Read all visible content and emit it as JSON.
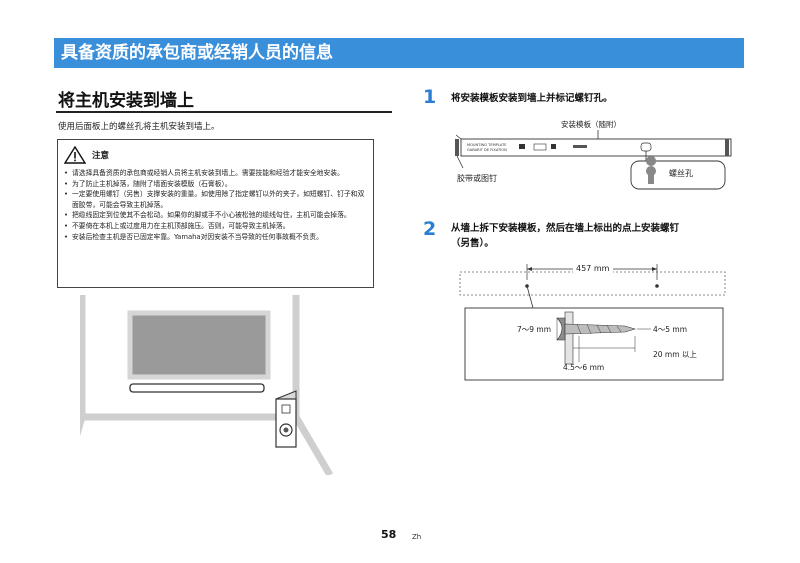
{
  "banner_title": "具备资质的承包商或经销人员的信息",
  "section_title": "将主机安装到墙上",
  "intro": "使用后面板上的螺丝孔将主机安装到墙上。",
  "caution": {
    "title": "注意",
    "items": [
      "请选择具备资质的承包商或经销人员将主机安装到墙上。需要技能和经验才能安全地安装。",
      "为了防止主机掉落，随附了墙面安装模版（石膏板）。",
      "一定要使用螺钉（另售）支撑安装的重量。如使用除了指定螺钉以外的夹子，如短螺钉、钉子和双面胶带，可能会导致主机掉落。",
      "把缆线固定到位使其不会松动。如果你的脚或手不小心被松弛的缆线勾住，主机可能会掉落。",
      "不要倚在本机上或过度用力在主机顶部施压。否则，可能导致主机掉落。",
      "安装后检查主机是否已固定牢靠。Yamaha对因安装不当导致的任何事故概不负责。"
    ]
  },
  "step1": {
    "number": "1",
    "text": "将安装模板安装到墙上并标记螺钉孔。",
    "template_label": "安装模板（随附）",
    "tape_label": "胶带或图钉",
    "hole_label": "螺丝孔",
    "template_print_1": "MOUNTING TEMPLATE",
    "template_print_2": "GABARIT DE FIXATION"
  },
  "step2": {
    "number": "2",
    "text_line1": "从墙上拆下安装模板，然后在墙上标出的点上安装螺钉",
    "text_line2": "（另售）。",
    "distance": "457 mm",
    "head_dim": "7～9 mm",
    "gap_dim": "4～5 mm",
    "length_dim": "20 mm 以上",
    "shank_dim": "4.5～6 mm"
  },
  "footer": {
    "page": "58",
    "lang": "Zh"
  }
}
